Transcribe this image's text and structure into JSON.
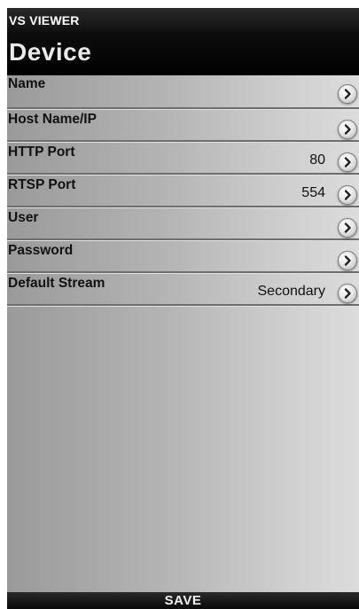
{
  "app": {
    "title": "VS VIEWER"
  },
  "page": {
    "title": "Device"
  },
  "settings": [
    {
      "label": "Name",
      "value": "",
      "icon": "chevron-right-icon"
    },
    {
      "label": "Host Name/IP",
      "value": "",
      "icon": "chevron-right-icon"
    },
    {
      "label": "HTTP Port",
      "value": "80",
      "icon": "chevron-right-icon"
    },
    {
      "label": "RTSP Port",
      "value": "554",
      "icon": "chevron-right-icon"
    },
    {
      "label": "User",
      "value": "",
      "icon": "chevron-right-icon"
    },
    {
      "label": "Password",
      "value": "",
      "icon": "chevron-right-icon"
    },
    {
      "label": "Default Stream",
      "value": "Secondary",
      "icon": "chevron-right-icon"
    }
  ],
  "footer": {
    "save_label": "SAVE"
  },
  "colors": {
    "titlebar": "#000000",
    "text": "#111111",
    "background": "#b4b4b4"
  }
}
